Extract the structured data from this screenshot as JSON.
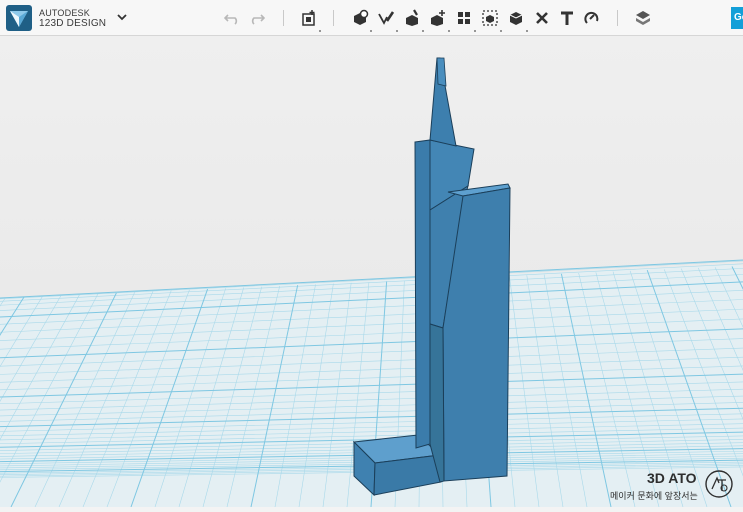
{
  "app": {
    "brand_line1": "AUTODESK",
    "brand_line2": "123D DESIGN",
    "menu_icon": "chevron-down-icon"
  },
  "toolbar": {
    "undo_icon": "undo-icon",
    "redo_icon": "redo-icon",
    "signin_label": "Ge",
    "tools": [
      "transform-icon",
      "primitives-icon",
      "sketch-icon",
      "construct-icon",
      "modify-icon",
      "pattern-icon",
      "grouping-icon",
      "combine-icon",
      "delete-icon",
      "text-icon",
      "snap-icon",
      "materials-icon"
    ]
  },
  "watermark": {
    "title": "3D ATO",
    "subtitle": "메이커 문화에 앞장서는"
  },
  "colors": {
    "model": "#3d7fae",
    "grid_background": "#e4eff3",
    "grid_line": "#9bd3e8",
    "accent": "#139fd8"
  }
}
